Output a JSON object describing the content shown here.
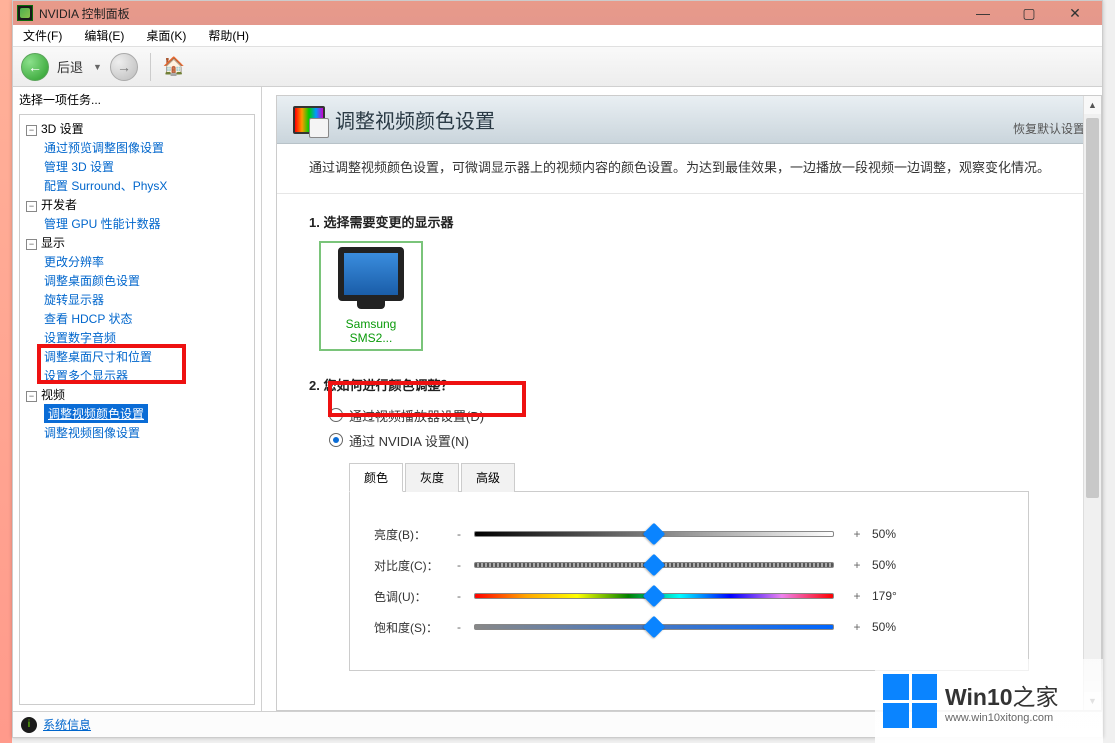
{
  "window": {
    "title": "NVIDIA 控制面板"
  },
  "menubar": [
    "文件(F)",
    "编辑(E)",
    "桌面(K)",
    "帮助(H)"
  ],
  "toolbar": {
    "back": "后退"
  },
  "sidebar": {
    "task_label": "选择一项任务...",
    "groups": [
      {
        "label": "3D 设置",
        "items": [
          "通过预览调整图像设置",
          "管理 3D 设置",
          "配置 Surround、PhysX"
        ]
      },
      {
        "label": "开发者",
        "items": [
          "管理 GPU 性能计数器"
        ]
      },
      {
        "label": "显示",
        "items": [
          "更改分辨率",
          "调整桌面颜色设置",
          "旋转显示器",
          "查看 HDCP 状态",
          "设置数字音频",
          "调整桌面尺寸和位置",
          "设置多个显示器"
        ]
      },
      {
        "label": "视频",
        "items": [
          "调整视频颜色设置",
          "调整视频图像设置"
        ]
      }
    ]
  },
  "content": {
    "title": "调整视频颜色设置",
    "restore": "恢复默认设置",
    "description": "通过调整视频颜色设置，可微调显示器上的视频内容的颜色设置。为达到最佳效果，一边播放一段视频一边调整，观察变化情况。",
    "step1": "1. 选择需要变更的显示器",
    "monitor": "Samsung SMS2...",
    "step2": "2. 您如何进行颜色调整？",
    "radio_player": "通过视频播放器设置(D)",
    "radio_nvidia": "通过 NVIDIA 设置(N)",
    "tabs": {
      "color": "颜色",
      "gamma": "灰度",
      "advanced": "高级"
    },
    "sliders": {
      "brightness": {
        "label": "亮度(B)：",
        "value": "50%",
        "pos": 50
      },
      "contrast": {
        "label": "对比度(C)：",
        "value": "50%",
        "pos": 50
      },
      "hue": {
        "label": "色调(U)：",
        "value": "179°",
        "pos": 50
      },
      "saturation": {
        "label": "饱和度(S)：",
        "value": "50%",
        "pos": 50
      }
    }
  },
  "statusbar": {
    "sysinfo": "系统信息"
  },
  "watermark": {
    "title_a": "Win10",
    "title_b": "之家",
    "url": "www.win10xitong.com"
  }
}
